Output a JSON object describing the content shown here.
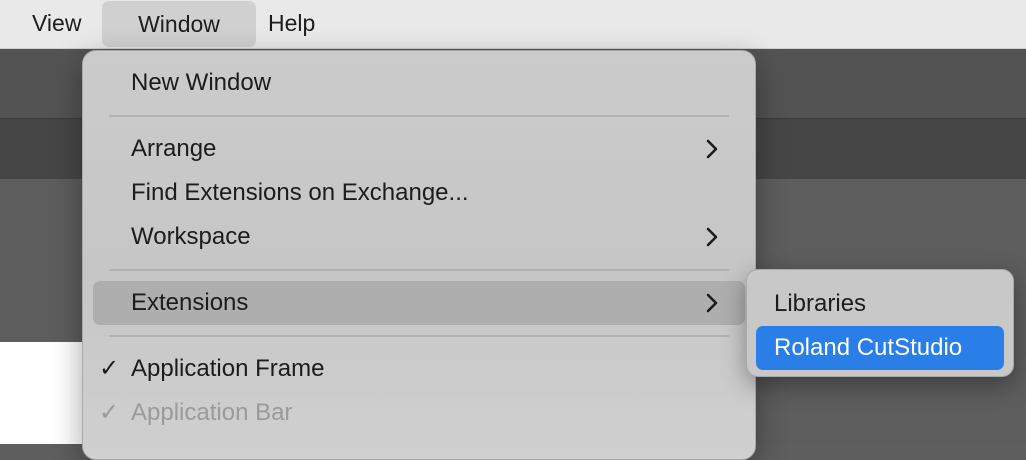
{
  "menubar": {
    "items": [
      "View",
      "Window",
      "Help"
    ]
  },
  "window_menu": {
    "items": [
      {
        "label": "New Window"
      },
      {
        "label": "Arrange",
        "has_submenu": true
      },
      {
        "label": "Find Extensions on Exchange..."
      },
      {
        "label": "Workspace",
        "has_submenu": true
      },
      {
        "label": "Extensions",
        "has_submenu": true,
        "highlighted": true
      },
      {
        "label": "Application Frame",
        "checked": true
      },
      {
        "label": "Application Bar",
        "checked": true,
        "disabled": true
      }
    ],
    "check_glyph": "✓"
  },
  "extensions_submenu": {
    "items": [
      {
        "label": "Libraries"
      },
      {
        "label": "Roland CutStudio",
        "selected": true
      }
    ],
    "selection_color": "#2a7ee8"
  }
}
